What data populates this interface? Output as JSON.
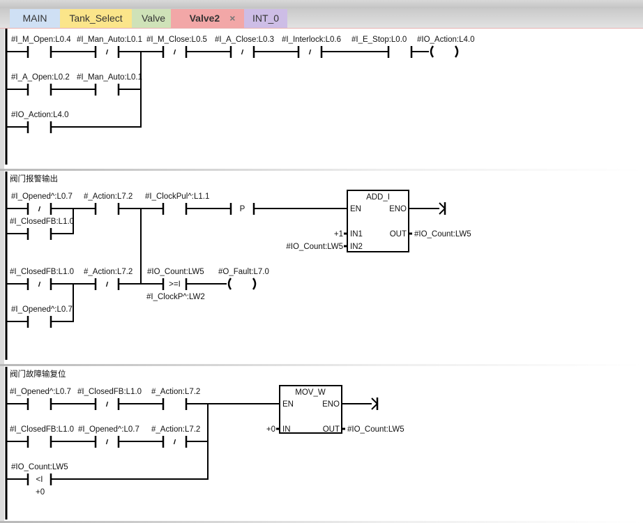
{
  "tabs": [
    {
      "label": "MAIN",
      "color": "#cfe0f4"
    },
    {
      "label": "Tank_Select",
      "color": "#fbe58a"
    },
    {
      "label": "Valve",
      "color": "#cfe2b8"
    },
    {
      "label": "Valve2",
      "color": "#f2a7a7",
      "active": true
    },
    {
      "label": "INT_0",
      "color": "#cdbde6"
    }
  ],
  "close_icon": "×",
  "networks": [
    {
      "title": "",
      "contacts": [
        "#I_M_Open:L0.4",
        "#I_Man_Auto:L0.1",
        "#I_M_Close:L0.5",
        "#I_A_Close:L0.3",
        "#I_Interlock:L0.6",
        "#I_E_Stop:L0.0",
        "#I_A_Open:L0.2",
        "#I_Man_Auto:L0.1",
        "#IO_Action:L4.0"
      ],
      "coil": "#IO_Action:L4.0"
    },
    {
      "title": "阀门报警输出",
      "contacts": [
        "#I_Opened^:L0.7",
        "#_Action:L7.2",
        "#I_ClockPul^:L1.1",
        "#I_ClosedFB:L1.0",
        "#I_ClosedFB:L1.0",
        "#_Action:L7.2",
        "#I_Opened^:L0.7"
      ],
      "edge": "P",
      "compare": {
        "in1": "#IO_Count:LW5",
        "op": ">=I",
        "in2": "#I_ClockP^:LW2"
      },
      "coil": "#O_Fault:L7.0",
      "box": {
        "name": "ADD_I",
        "en": "EN",
        "eno": "ENO",
        "in1": "IN1",
        "in2": "IN2",
        "out": "OUT",
        "in1_val": "+1",
        "in2_val": "#IO_Count:LW5",
        "out_val": "#IO_Count:LW5"
      }
    },
    {
      "title": "阀门故障输复位",
      "contacts": [
        "#I_Opened^:L0.7",
        "#I_ClosedFB:L1.0",
        "#_Action:L7.2",
        "#I_ClosedFB:L1.0",
        "#I_Opened^:L0.7",
        "#_Action:L7.2"
      ],
      "compare": {
        "in1": "#IO_Count:LW5",
        "op": "<I",
        "in2": "+0"
      },
      "box": {
        "name": "MOV_W",
        "en": "EN",
        "eno": "ENO",
        "in": "IN",
        "out": "OUT",
        "in_val": "+0",
        "out_val": "#IO_Count:LW5"
      }
    }
  ],
  "colors": {
    "comment": "#1a7a1a",
    "constant": "#7a7a00",
    "active_tab_text": "#222"
  }
}
